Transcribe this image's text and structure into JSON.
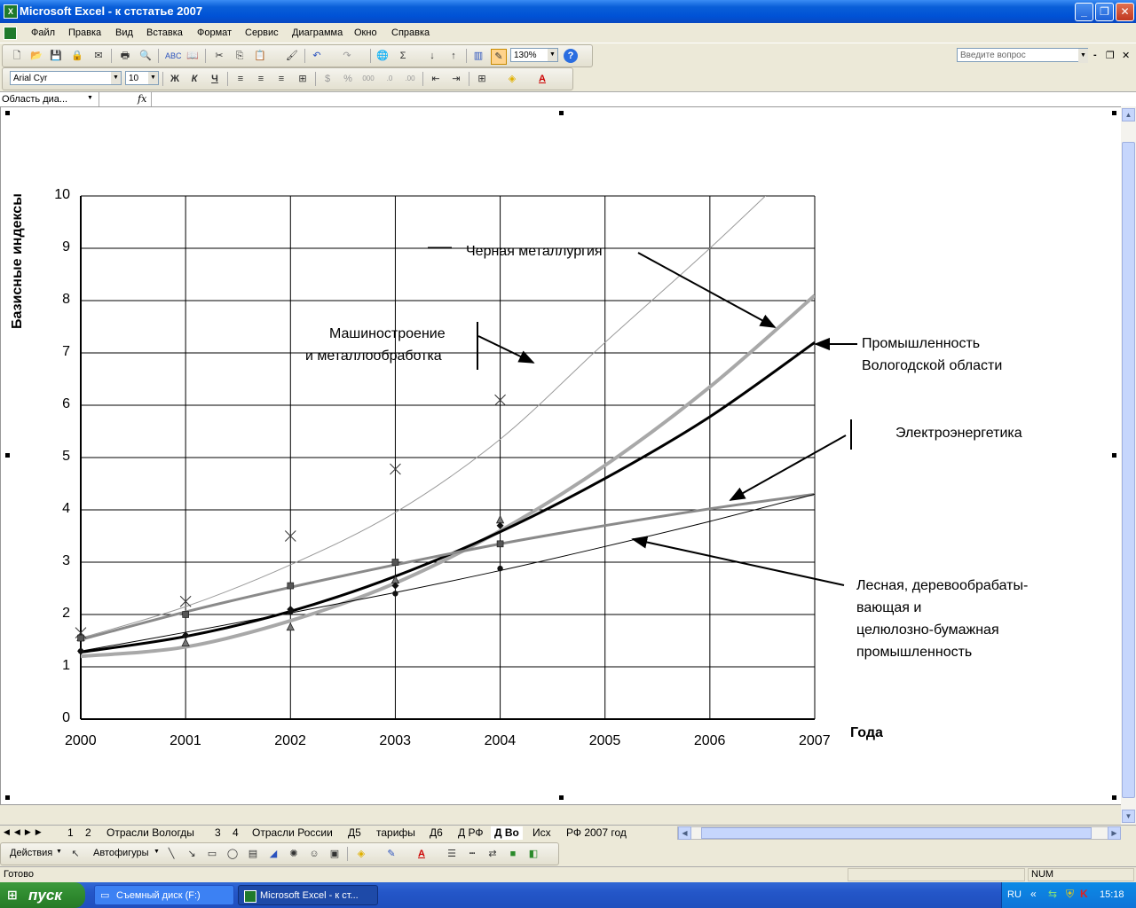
{
  "window": {
    "title": "Microsoft Excel - к стстатье 2007",
    "minimize": "_",
    "restore": "❐",
    "close": "✕"
  },
  "menu": {
    "items": [
      "Файл",
      "Правка",
      "Вид",
      "Вставка",
      "Формат",
      "Сервис",
      "Диаграмма",
      "Окно",
      "Справка"
    ],
    "ask_placeholder": "Введите вопрос",
    "doc_min": "-",
    "doc_restore": "❐",
    "doc_close": "✕"
  },
  "toolbar": {
    "zoom": "130%",
    "font": "Arial Cyr",
    "size": "10",
    "bold": "Ж",
    "italic": "К",
    "underline": "Ч"
  },
  "formula": {
    "namebox": "Область диа...",
    "fx": "fx"
  },
  "chart_data": {
    "type": "line",
    "title": "",
    "ylabel": "Базисные индексы",
    "xlabel": "Года",
    "categories": [
      "2000",
      "2001",
      "2002",
      "2003",
      "2004",
      "2005",
      "2006",
      "2007"
    ],
    "ylim": [
      0,
      10
    ],
    "yticks": [
      "0",
      "1",
      "2",
      "3",
      "4",
      "5",
      "6",
      "7",
      "8",
      "9",
      "10"
    ],
    "grid": true,
    "series_points": [
      {
        "marker": "x",
        "values": [
          1.65,
          2.25,
          3.5,
          4.78,
          6.1
        ]
      },
      {
        "marker": "triangle",
        "values": [
          1.55,
          1.45,
          1.75,
          2.65,
          3.8
        ]
      },
      {
        "marker": "square",
        "values": [
          1.55,
          2.0,
          2.55,
          3.0,
          3.35
        ]
      },
      {
        "marker": "diamond",
        "values": [
          1.3,
          1.6,
          2.1,
          2.55,
          3.7
        ]
      },
      {
        "marker": "dot",
        "values": [
          1.3,
          1.6,
          2.05,
          2.4,
          2.88
        ]
      }
    ],
    "trendlines": [
      {
        "style": "thin-gray",
        "values": [
          1.55,
          2.15,
          2.95,
          3.95,
          5.35,
          7.2,
          9.0,
          10.9
        ]
      },
      {
        "style": "thick-lightgray",
        "values": [
          1.2,
          1.38,
          1.88,
          2.6,
          3.6,
          4.85,
          6.35,
          8.1
        ]
      },
      {
        "style": "thick-black",
        "values": [
          1.28,
          1.58,
          2.06,
          2.73,
          3.58,
          4.6,
          5.78,
          7.2
        ]
      },
      {
        "style": "medium-gray",
        "values": [
          1.52,
          2.05,
          2.52,
          2.95,
          3.35,
          3.7,
          4.02,
          4.3
        ]
      },
      {
        "style": "thin-black",
        "values": [
          1.3,
          1.66,
          2.03,
          2.42,
          2.84,
          3.3,
          3.78,
          4.3
        ]
      }
    ],
    "annotations": [
      {
        "text": "Черная металлургия"
      },
      {
        "text": "Машиностроение"
      },
      {
        "text": "и металлообработка"
      },
      {
        "text": "Промышленность"
      },
      {
        "text": "Вологодской области"
      },
      {
        "text": "Электроэнергетика"
      },
      {
        "text": "Лесная, деревообрабаты-"
      },
      {
        "text": "вающая и"
      },
      {
        "text": "целюлозно-бумажная"
      },
      {
        "text": "промышленность"
      }
    ]
  },
  "sheet_tabs": {
    "items": [
      "1",
      "2",
      "Отрасли Вологды",
      "3",
      "4",
      "Отрасли России",
      "Д5",
      "тарифы",
      "Д6",
      "Д РФ",
      "Д Во",
      "Исх",
      "РФ 2007 год"
    ],
    "active": "Д Во"
  },
  "drawing": {
    "actions": "Действия",
    "autoshapes": "Автофигуры"
  },
  "status": {
    "left": "Готово",
    "num": "NUM"
  },
  "taskbar": {
    "start": "пуск",
    "items": [
      "Съемный диск (F:)",
      "Microsoft Excel - к ст..."
    ],
    "lang": "RU",
    "clock": "15:18"
  },
  "colors": {
    "taskbar": "#245edb",
    "start": "#3c9a3c",
    "titlebar": "#0a5fd8"
  }
}
